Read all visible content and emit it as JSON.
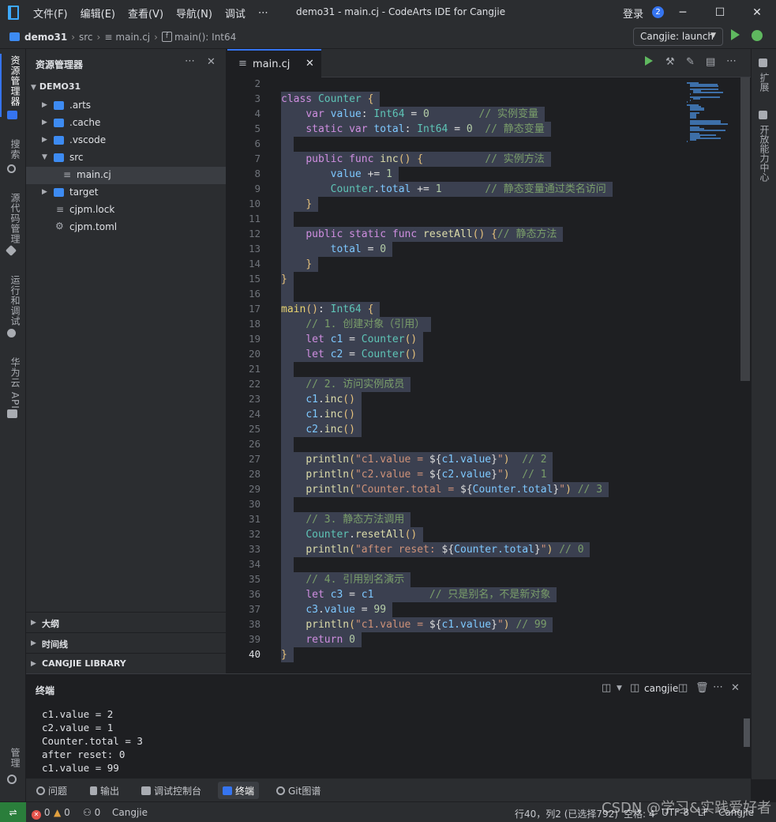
{
  "titlebar": {
    "menus": [
      "文件(F)",
      "编辑(E)",
      "查看(V)",
      "导航(N)",
      "调试",
      "⋯"
    ],
    "window_title": "demo31 - main.cj - CodeArts IDE for Cangjie",
    "login": "登录",
    "notification_count": "2"
  },
  "navbar": {
    "project": "demo31",
    "crumbs": [
      "src",
      "main.cj",
      "main(): Int64"
    ],
    "run_config": "Cangjie: launch"
  },
  "activitybar": [
    "资源管理器",
    "搜索",
    "源代码管理",
    "运行和调试",
    "华为云 API",
    "管理"
  ],
  "rightbar": [
    "扩展",
    "开放能力中心"
  ],
  "explorer": {
    "title": "资源管理器",
    "root": "DEMO31",
    "items": [
      {
        "label": ".arts",
        "type": "folder",
        "depth": 1,
        "expanded": false
      },
      {
        "label": ".cache",
        "type": "folder",
        "depth": 1,
        "expanded": false
      },
      {
        "label": ".vscode",
        "type": "folder",
        "depth": 1,
        "expanded": false
      },
      {
        "label": "src",
        "type": "folder",
        "depth": 1,
        "expanded": true
      },
      {
        "label": "main.cj",
        "type": "file",
        "depth": 2,
        "selected": true
      },
      {
        "label": "target",
        "type": "folder",
        "depth": 1,
        "expanded": false
      },
      {
        "label": "cjpm.lock",
        "type": "file",
        "depth": 1
      },
      {
        "label": "cjpm.toml",
        "type": "gear-file",
        "depth": 1
      }
    ],
    "sections": [
      "大纲",
      "时间线",
      "CANGJIE LIBRARY"
    ]
  },
  "editor": {
    "tab": "main.cj",
    "lines": [
      {
        "n": "2",
        "code": ""
      },
      {
        "n": "3",
        "code": "class Counter {"
      },
      {
        "n": "4",
        "code": "    var value: Int64 = 0        // 实例变量"
      },
      {
        "n": "5",
        "code": "    static var total: Int64 = 0  // 静态变量"
      },
      {
        "n": "6",
        "code": ""
      },
      {
        "n": "7",
        "code": "    public func inc() {          // 实例方法"
      },
      {
        "n": "8",
        "code": "        value += 1"
      },
      {
        "n": "9",
        "code": "        Counter.total += 1       // 静态变量通过类名访问"
      },
      {
        "n": "10",
        "code": "    }"
      },
      {
        "n": "11",
        "code": ""
      },
      {
        "n": "12",
        "code": "    public static func resetAll() {// 静态方法"
      },
      {
        "n": "13",
        "code": "        total = 0"
      },
      {
        "n": "14",
        "code": "    }"
      },
      {
        "n": "15",
        "code": "}"
      },
      {
        "n": "16",
        "code": ""
      },
      {
        "n": "17",
        "code": "main(): Int64 {"
      },
      {
        "n": "18",
        "code": "    // 1. 创建对象（引用）"
      },
      {
        "n": "19",
        "code": "    let c1 = Counter()"
      },
      {
        "n": "20",
        "code": "    let c2 = Counter()"
      },
      {
        "n": "21",
        "code": ""
      },
      {
        "n": "22",
        "code": "    // 2. 访问实例成员"
      },
      {
        "n": "23",
        "code": "    c1.inc()"
      },
      {
        "n": "24",
        "code": "    c1.inc()"
      },
      {
        "n": "25",
        "code": "    c2.inc()"
      },
      {
        "n": "26",
        "code": ""
      },
      {
        "n": "27",
        "code": "    println(\"c1.value = ${c1.value}\")  // 2"
      },
      {
        "n": "28",
        "code": "    println(\"c2.value = ${c2.value}\")  // 1"
      },
      {
        "n": "29",
        "code": "    println(\"Counter.total = ${Counter.total}\") // 3"
      },
      {
        "n": "30",
        "code": ""
      },
      {
        "n": "31",
        "code": "    // 3. 静态方法调用"
      },
      {
        "n": "32",
        "code": "    Counter.resetAll()"
      },
      {
        "n": "33",
        "code": "    println(\"after reset: ${Counter.total}\") // 0"
      },
      {
        "n": "34",
        "code": ""
      },
      {
        "n": "35",
        "code": "    // 4. 引用别名演示"
      },
      {
        "n": "36",
        "code": "    let c3 = c1         // 只是别名，不是新对象"
      },
      {
        "n": "37",
        "code": "    c3.value = 99"
      },
      {
        "n": "38",
        "code": "    println(\"c1.value = ${c1.value}\") // 99"
      },
      {
        "n": "39",
        "code": "    return 0"
      },
      {
        "n": "40",
        "code": "}"
      }
    ]
  },
  "terminal": {
    "title": "终端",
    "shell": "cangjie",
    "output": [
      "c1.value = 2",
      "c2.value = 1",
      "Counter.total = 3",
      "after reset: 0",
      "c1.value = 99"
    ]
  },
  "bottom_tabs": [
    "问题",
    "输出",
    "调试控制台",
    "终端",
    "Git图谱"
  ],
  "statusbar": {
    "errors": "0",
    "warnings": "0",
    "ports": "0",
    "project": "Cangjie",
    "position": "行40，列2 (已选择792)",
    "indent": "空格: 4",
    "encoding": "UTF-8",
    "eol": "LF",
    "language": "Cangjie"
  },
  "watermark": "CSDN @学习&实践爱好者",
  "colors": {
    "accent": "#3574f0",
    "selection": "#3b4050",
    "remote": "#2a7e3b"
  }
}
